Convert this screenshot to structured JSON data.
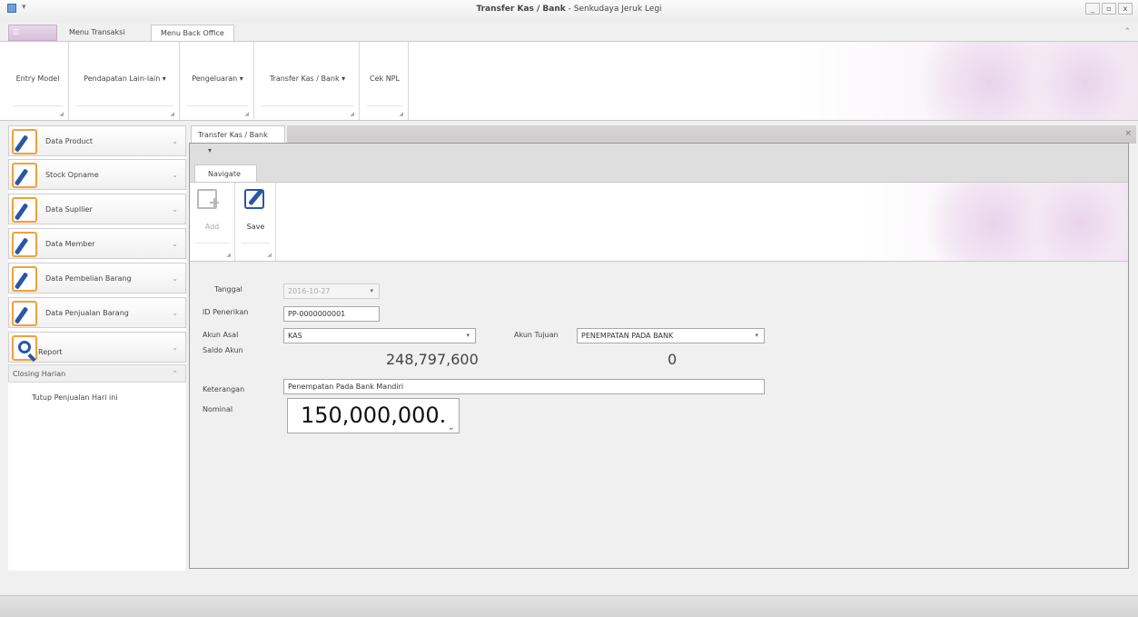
{
  "window": {
    "title_bold": "Transfer Kas / Bank",
    "title_rest": " - Senkudaya Jeruk Legi",
    "controls": [
      "_",
      "▫",
      "x"
    ],
    "qat_glyph": "▾",
    "collapse_glyph": "⌃"
  },
  "app_button": "☰",
  "ribbon_tabs": [
    {
      "label": "Menu Transaksi",
      "active": false
    },
    {
      "label": "Menu Back Office",
      "active": true
    }
  ],
  "ribbon_groups": [
    {
      "label": "Entry Model"
    },
    {
      "label": "Pendapatan Lain-lain ▾"
    },
    {
      "label": "Pengeluaran ▾"
    },
    {
      "label": "Transfer Kas / Bank ▾"
    },
    {
      "label": "Cek NPL"
    }
  ],
  "sidebar": {
    "groups": [
      {
        "label": "Data Product",
        "icon": "pencil-icon"
      },
      {
        "label": "Stock Opname",
        "icon": "pencil-icon"
      },
      {
        "label": "Data Supllier",
        "icon": "pencil-icon"
      },
      {
        "label": "Data Member",
        "icon": "pencil-icon"
      },
      {
        "label": "Data Pembelian Barang",
        "icon": "pencil-icon"
      },
      {
        "label": "Data Penjualan Barang",
        "icon": "pencil-icon"
      },
      {
        "label": "Report",
        "icon": "magnifier-icon"
      }
    ],
    "chevron": "⌄",
    "closing": {
      "label": "Closing Harian",
      "chevron": "⌃",
      "items": [
        "Tutup Penjualan Hari ini"
      ]
    }
  },
  "document": {
    "tab_label": "Transfer Kas / Bank",
    "close_glyph": "×",
    "qat_glyph": "▾",
    "ribbon_tab": "Navigate",
    "buttons": [
      {
        "label": "Add",
        "enabled": false,
        "icon": "add-icon"
      },
      {
        "label": "Save",
        "enabled": true,
        "icon": "save-icon"
      }
    ]
  },
  "form": {
    "tanggal": {
      "label": "Tanggal",
      "value": "2016-10-27"
    },
    "id_penerikan": {
      "label": "ID Penerikan",
      "value": "PP-0000000001"
    },
    "akun_asal": {
      "label": "Akun Asal",
      "value": "KAS"
    },
    "akun_tujuan": {
      "label": "Akun Tujuan",
      "value": "PENEMPATAN PADA BANK"
    },
    "saldo_akun": {
      "label": "Saldo Akun",
      "asal": "248,797,600",
      "tujuan": "0"
    },
    "keterangan": {
      "label": "Keterangan",
      "value": "Penempatan Pada Bank Mandiri"
    },
    "nominal": {
      "label": "Nominal",
      "value": "150,000,000."
    },
    "dropdown_glyph": "▾",
    "spin_glyph": "⌄"
  }
}
